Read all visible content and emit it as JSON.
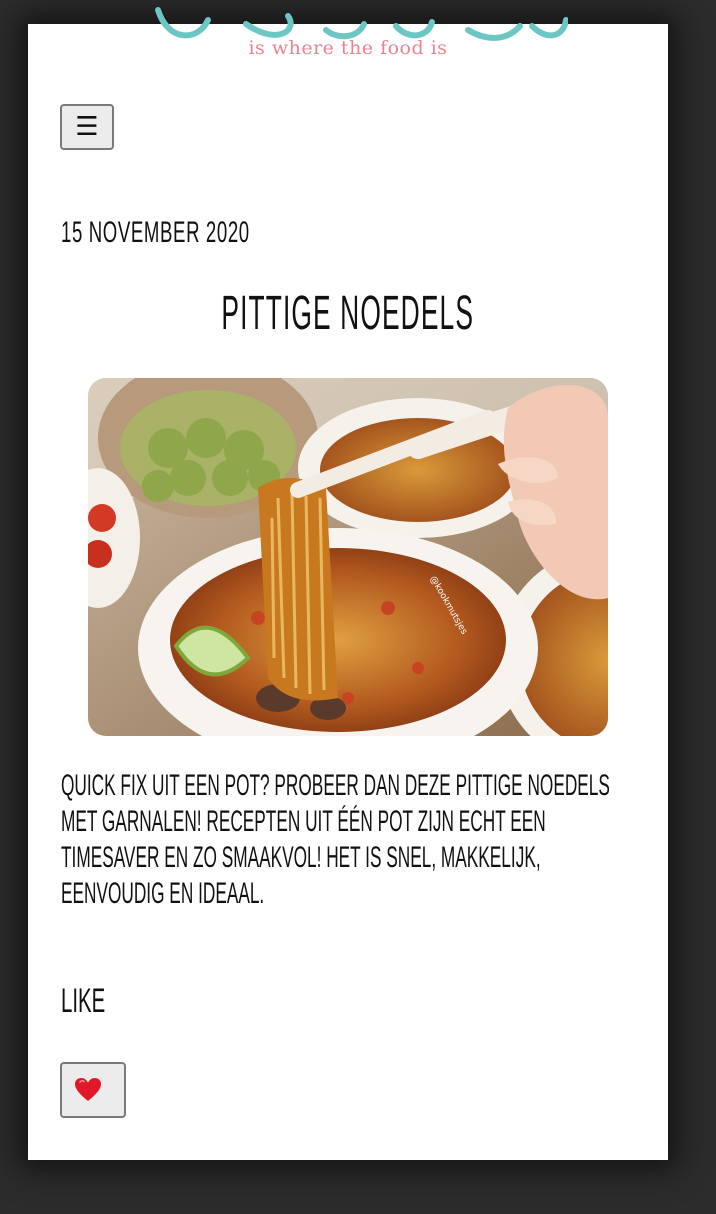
{
  "site": {
    "tagline": "is where the food is"
  },
  "navigation": {
    "menu_icon": "hamburger-icon",
    "menu_glyph": "☰"
  },
  "post": {
    "date": "15 november 2020",
    "title": "PITTIGE NOEDELS",
    "image_watermark": "@kookmutsjes",
    "intro": "QUICK FIX UIT EEN POT? PROBEER DAN DEZE PITTIGE NOEDELS MET GARNALEN! RECEPTEN UIT ÉÉN POT ZIJN ECHT EEN TIMESAVER EN ZO SMAAKVOL! HET IS SNEL, MAKKELIJK, EENVOUDIG EN IDEAAL."
  },
  "like": {
    "heading": "LIKE",
    "button_icon": "heart-icon"
  },
  "colors": {
    "page_background": "#2c2c2c",
    "card_background": "#ffffff",
    "logo_teal": "#6cc6c3",
    "tagline_pink": "#e8848f",
    "heart_red": "#e0182a"
  }
}
